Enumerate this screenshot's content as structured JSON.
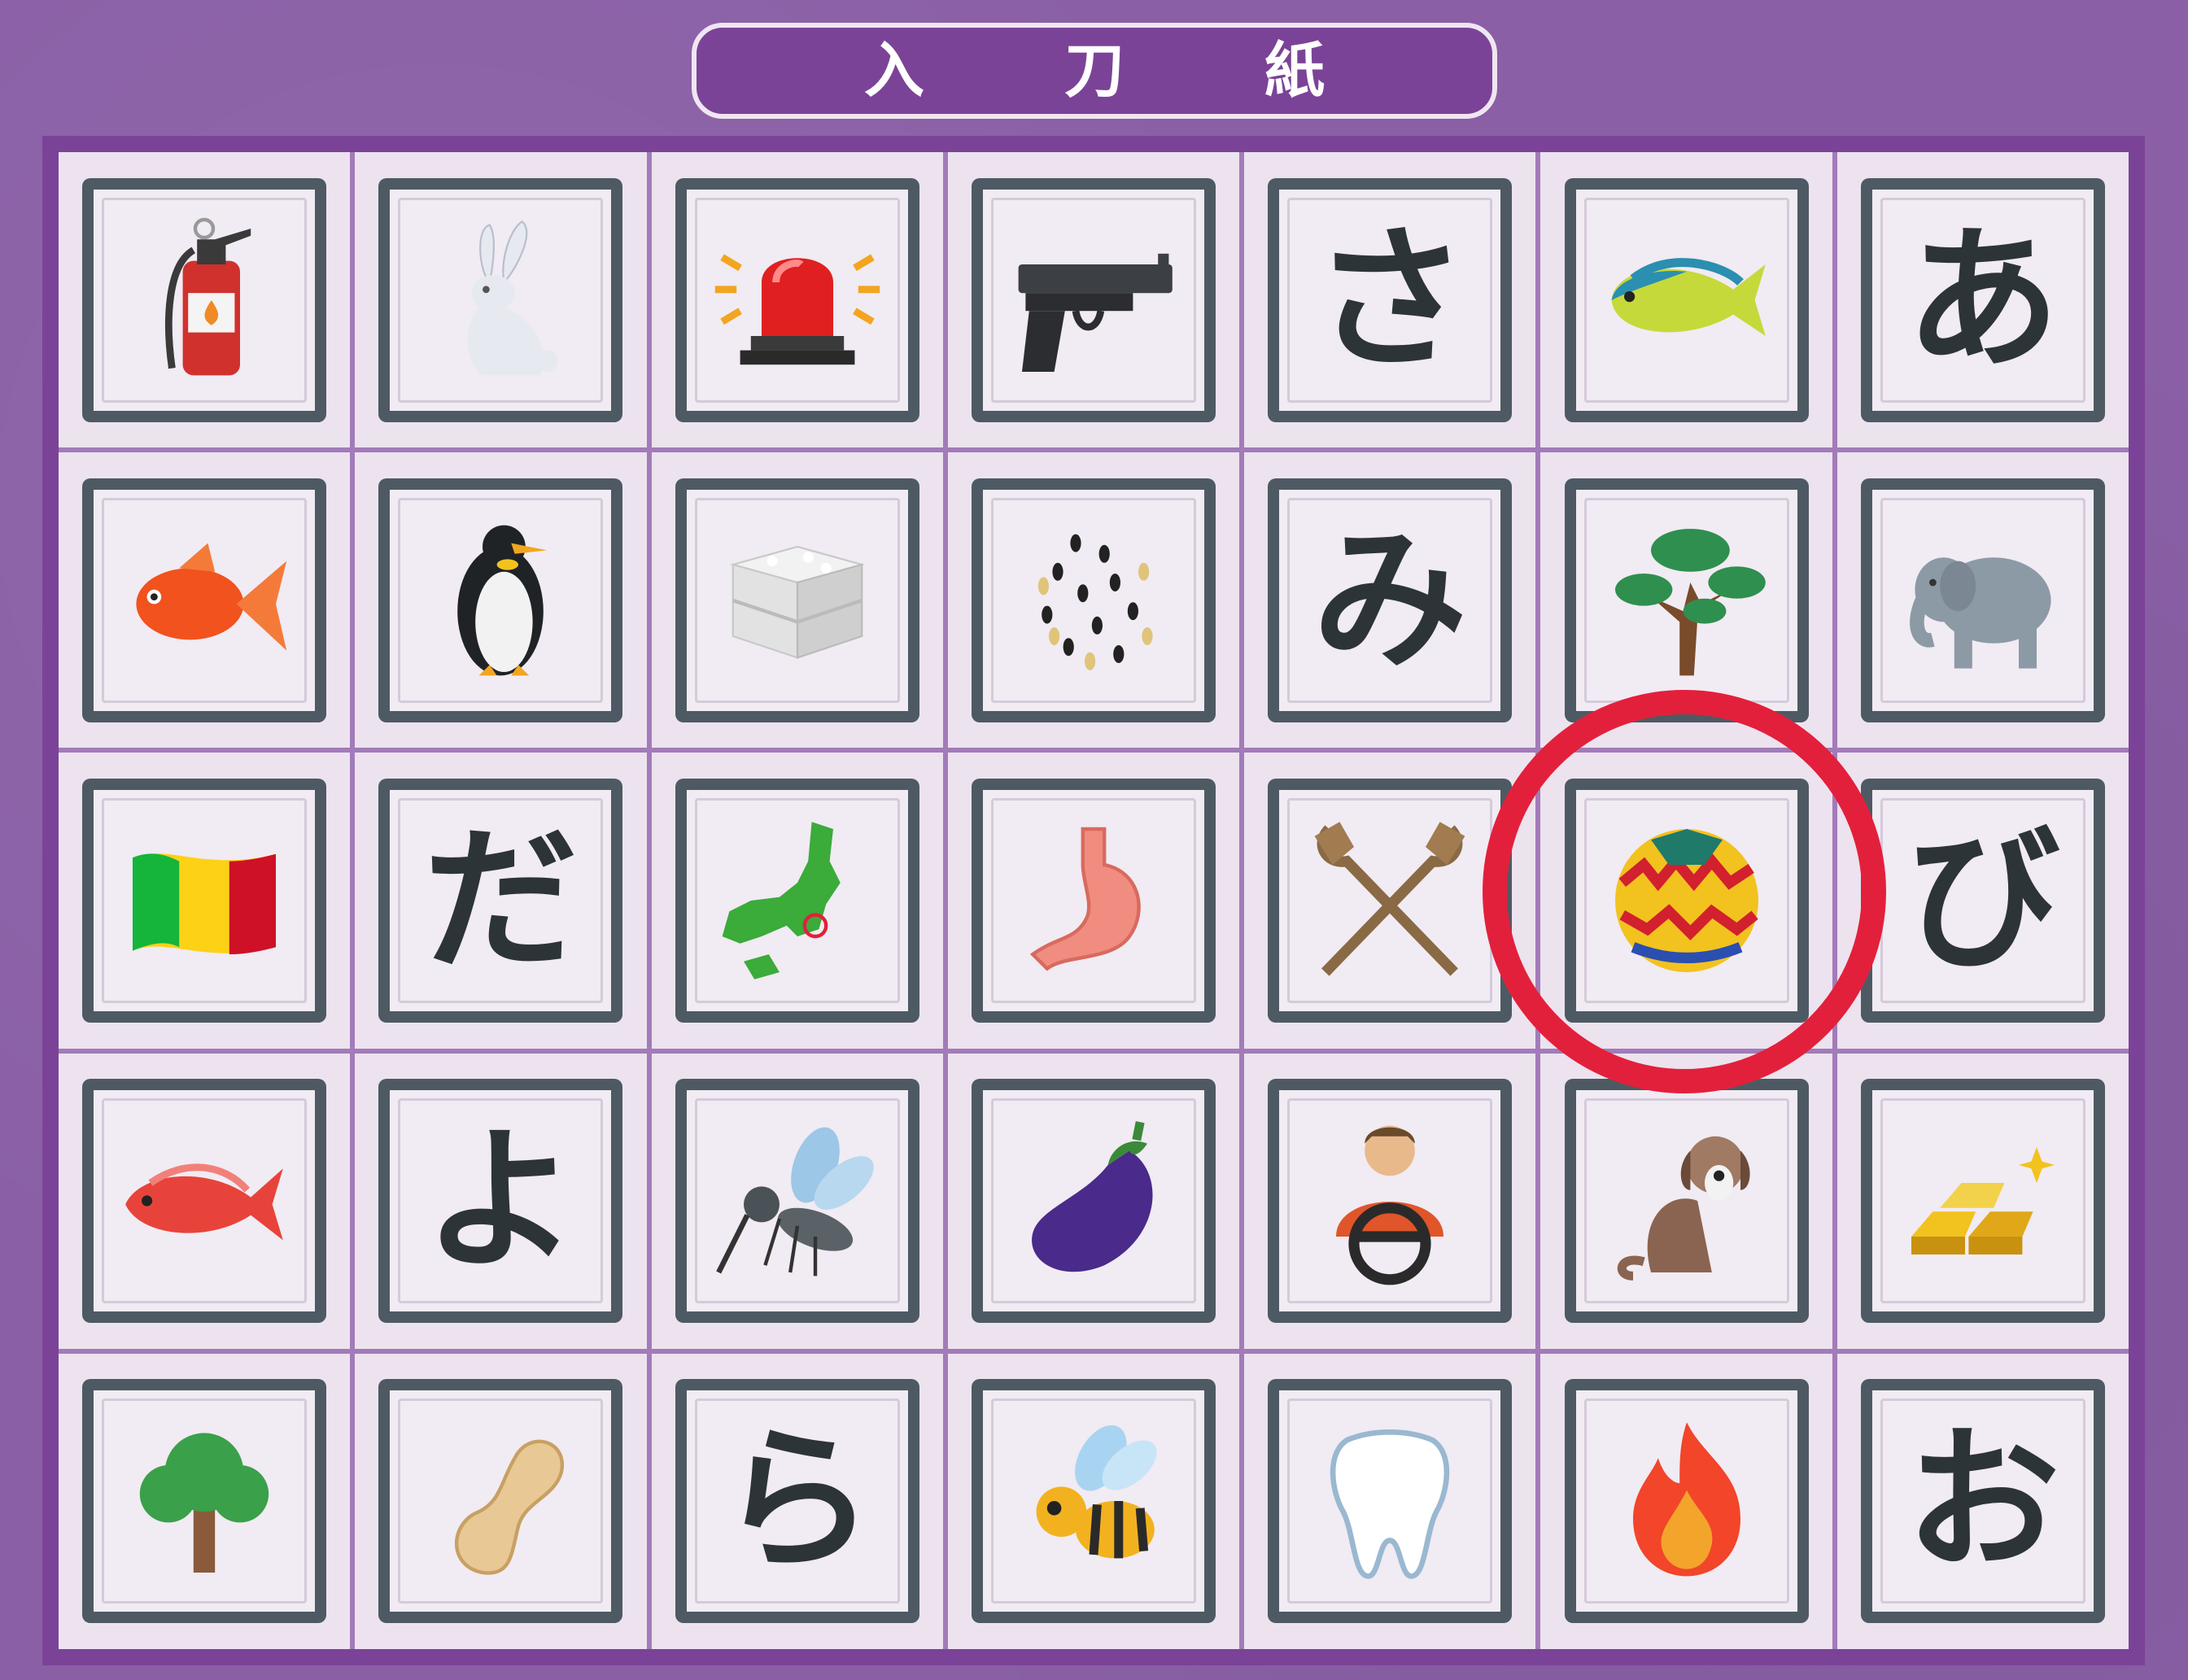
{
  "title": {
    "chars": [
      "入",
      "刀",
      "紙"
    ]
  },
  "grid": {
    "rows": [
      [
        {
          "kind": "icon",
          "icon": "fire-extinguisher-icon"
        },
        {
          "kind": "icon",
          "icon": "rabbit-icon"
        },
        {
          "kind": "icon",
          "icon": "siren-light-icon"
        },
        {
          "kind": "icon",
          "icon": "handgun-icon"
        },
        {
          "kind": "text",
          "text": "さ"
        },
        {
          "kind": "icon",
          "icon": "mahi-mahi-fish-icon"
        },
        {
          "kind": "text",
          "text": "あ"
        }
      ],
      [
        {
          "kind": "icon",
          "icon": "goldfish-icon"
        },
        {
          "kind": "icon",
          "icon": "penguin-icon"
        },
        {
          "kind": "icon",
          "icon": "steamer-box-icon"
        },
        {
          "kind": "icon",
          "icon": "sesame-seeds-icon"
        },
        {
          "kind": "text",
          "text": "み"
        },
        {
          "kind": "icon",
          "icon": "pine-tree-icon"
        },
        {
          "kind": "icon",
          "icon": "elephant-icon"
        }
      ],
      [
        {
          "kind": "icon",
          "icon": "mali-flag-icon"
        },
        {
          "kind": "text",
          "text": "だ"
        },
        {
          "kind": "icon",
          "icon": "japan-map-icon"
        },
        {
          "kind": "icon",
          "icon": "stomach-icon"
        },
        {
          "kind": "icon",
          "icon": "oars-icon"
        },
        {
          "kind": "icon",
          "icon": "temari-ball-icon",
          "selected": true
        },
        {
          "kind": "text",
          "text": "び"
        }
      ],
      [
        {
          "kind": "icon",
          "icon": "sea-bream-icon"
        },
        {
          "kind": "text",
          "text": "よ"
        },
        {
          "kind": "icon",
          "icon": "mosquito-icon"
        },
        {
          "kind": "icon",
          "icon": "eggplant-icon"
        },
        {
          "kind": "icon",
          "icon": "driver-icon"
        },
        {
          "kind": "icon",
          "icon": "dog-icon"
        },
        {
          "kind": "icon",
          "icon": "gold-bars-icon"
        }
      ],
      [
        {
          "kind": "icon",
          "icon": "tree-icon"
        },
        {
          "kind": "icon",
          "icon": "peanut-icon"
        },
        {
          "kind": "text",
          "text": "ら"
        },
        {
          "kind": "icon",
          "icon": "bee-icon"
        },
        {
          "kind": "icon",
          "icon": "tooth-icon"
        },
        {
          "kind": "icon",
          "icon": "fire-icon"
        },
        {
          "kind": "text",
          "text": "お"
        }
      ]
    ]
  },
  "selection": {
    "row": 2,
    "col": 5,
    "color": "#e3203b"
  },
  "colors": {
    "board": "#7b4397",
    "card_frame": "#4e5a63",
    "kana": "#2c3438"
  }
}
